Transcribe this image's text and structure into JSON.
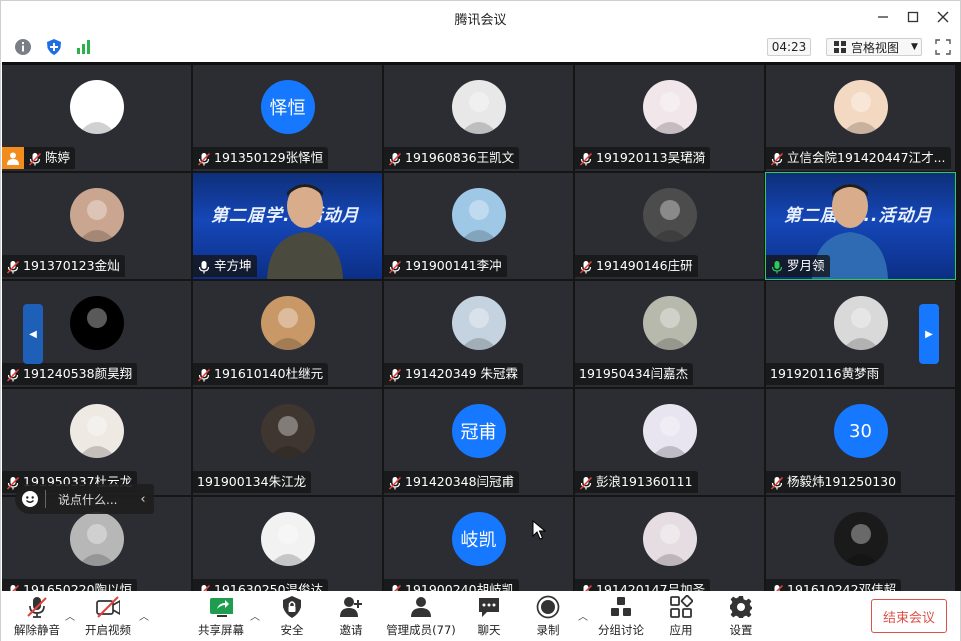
{
  "window": {
    "title": "腾讯会议"
  },
  "toolbar": {
    "timer": "04:23",
    "view_mode": "宫格视图"
  },
  "tiles": [
    {
      "name": "陈婷",
      "avatar": "img",
      "av": "#fff",
      "host": true
    },
    {
      "name": "191350129张怿恒",
      "avatar": "text",
      "text": "怿恒"
    },
    {
      "name": "191960836王凯文",
      "avatar": "img",
      "av": "#e8e8e8"
    },
    {
      "name": "191920113吴珺漪",
      "avatar": "img",
      "av": "#f1e6ea"
    },
    {
      "name": "立信会院191420447江才...",
      "avatar": "img",
      "av": "#f4d9c2"
    },
    {
      "name": "191370123金灿",
      "avatar": "img",
      "av": "#caa58f"
    },
    {
      "name": "辛方坤",
      "avatar": "video",
      "banner": "第二届学...活动月"
    },
    {
      "name": "191900141李冲",
      "avatar": "img",
      "av": "#9fc8e6"
    },
    {
      "name": "191490146庄研",
      "avatar": "img",
      "av": "#4c4c4c"
    },
    {
      "name": "罗月领",
      "avatar": "video",
      "banner": "第二届学...活动月",
      "speaking": true
    },
    {
      "name": "191240538颜昊翔",
      "avatar": "img",
      "av": "#000"
    },
    {
      "name": "191610140杜继元",
      "avatar": "img",
      "av": "#c99867"
    },
    {
      "name": "191420349 朱冠霖",
      "avatar": "img",
      "av": "#c5d3e0"
    },
    {
      "name": "191950434闫嘉杰",
      "avatar": "img",
      "av": "#b7b9ac",
      "nomic": true
    },
    {
      "name": "191920116黄梦雨",
      "avatar": "img",
      "av": "#d9d9d9",
      "nomic": true
    },
    {
      "name": "191950337杜云龙",
      "avatar": "img",
      "av": "#efe9e4"
    },
    {
      "name": "191900134朱江龙",
      "avatar": "img",
      "av": "#403630",
      "nomic": true
    },
    {
      "name": "191420348闫冠甫",
      "avatar": "text",
      "text": "冠甫"
    },
    {
      "name": "彭浪191360111",
      "avatar": "img",
      "av": "#e8e4f0"
    },
    {
      "name": "杨毅炜191250130",
      "avatar": "text",
      "text": "30"
    },
    {
      "name": "191650220陶以恒",
      "avatar": "img",
      "av": "#b7b7b7"
    },
    {
      "name": "191630250温俊达",
      "avatar": "img",
      "av": "#f2f2f2"
    },
    {
      "name": "191900240胡岐凯",
      "avatar": "text",
      "text": "岐凯"
    },
    {
      "name": "191420147吕加圣",
      "avatar": "img",
      "av": "#e6dde2"
    },
    {
      "name": "191610242邓伟超",
      "avatar": "img",
      "av": "#1a1a1a"
    }
  ],
  "chat": {
    "placeholder": "说点什么..."
  },
  "bottombar": {
    "unmute": "解除静音",
    "start_video": "开启视频",
    "share": "共享屏幕",
    "security": "安全",
    "invite": "邀请",
    "members": "管理成员(77)",
    "chat": "聊天",
    "record": "录制",
    "breakout": "分组讨论",
    "apps": "应用",
    "settings": "设置",
    "end": "结束会议"
  }
}
